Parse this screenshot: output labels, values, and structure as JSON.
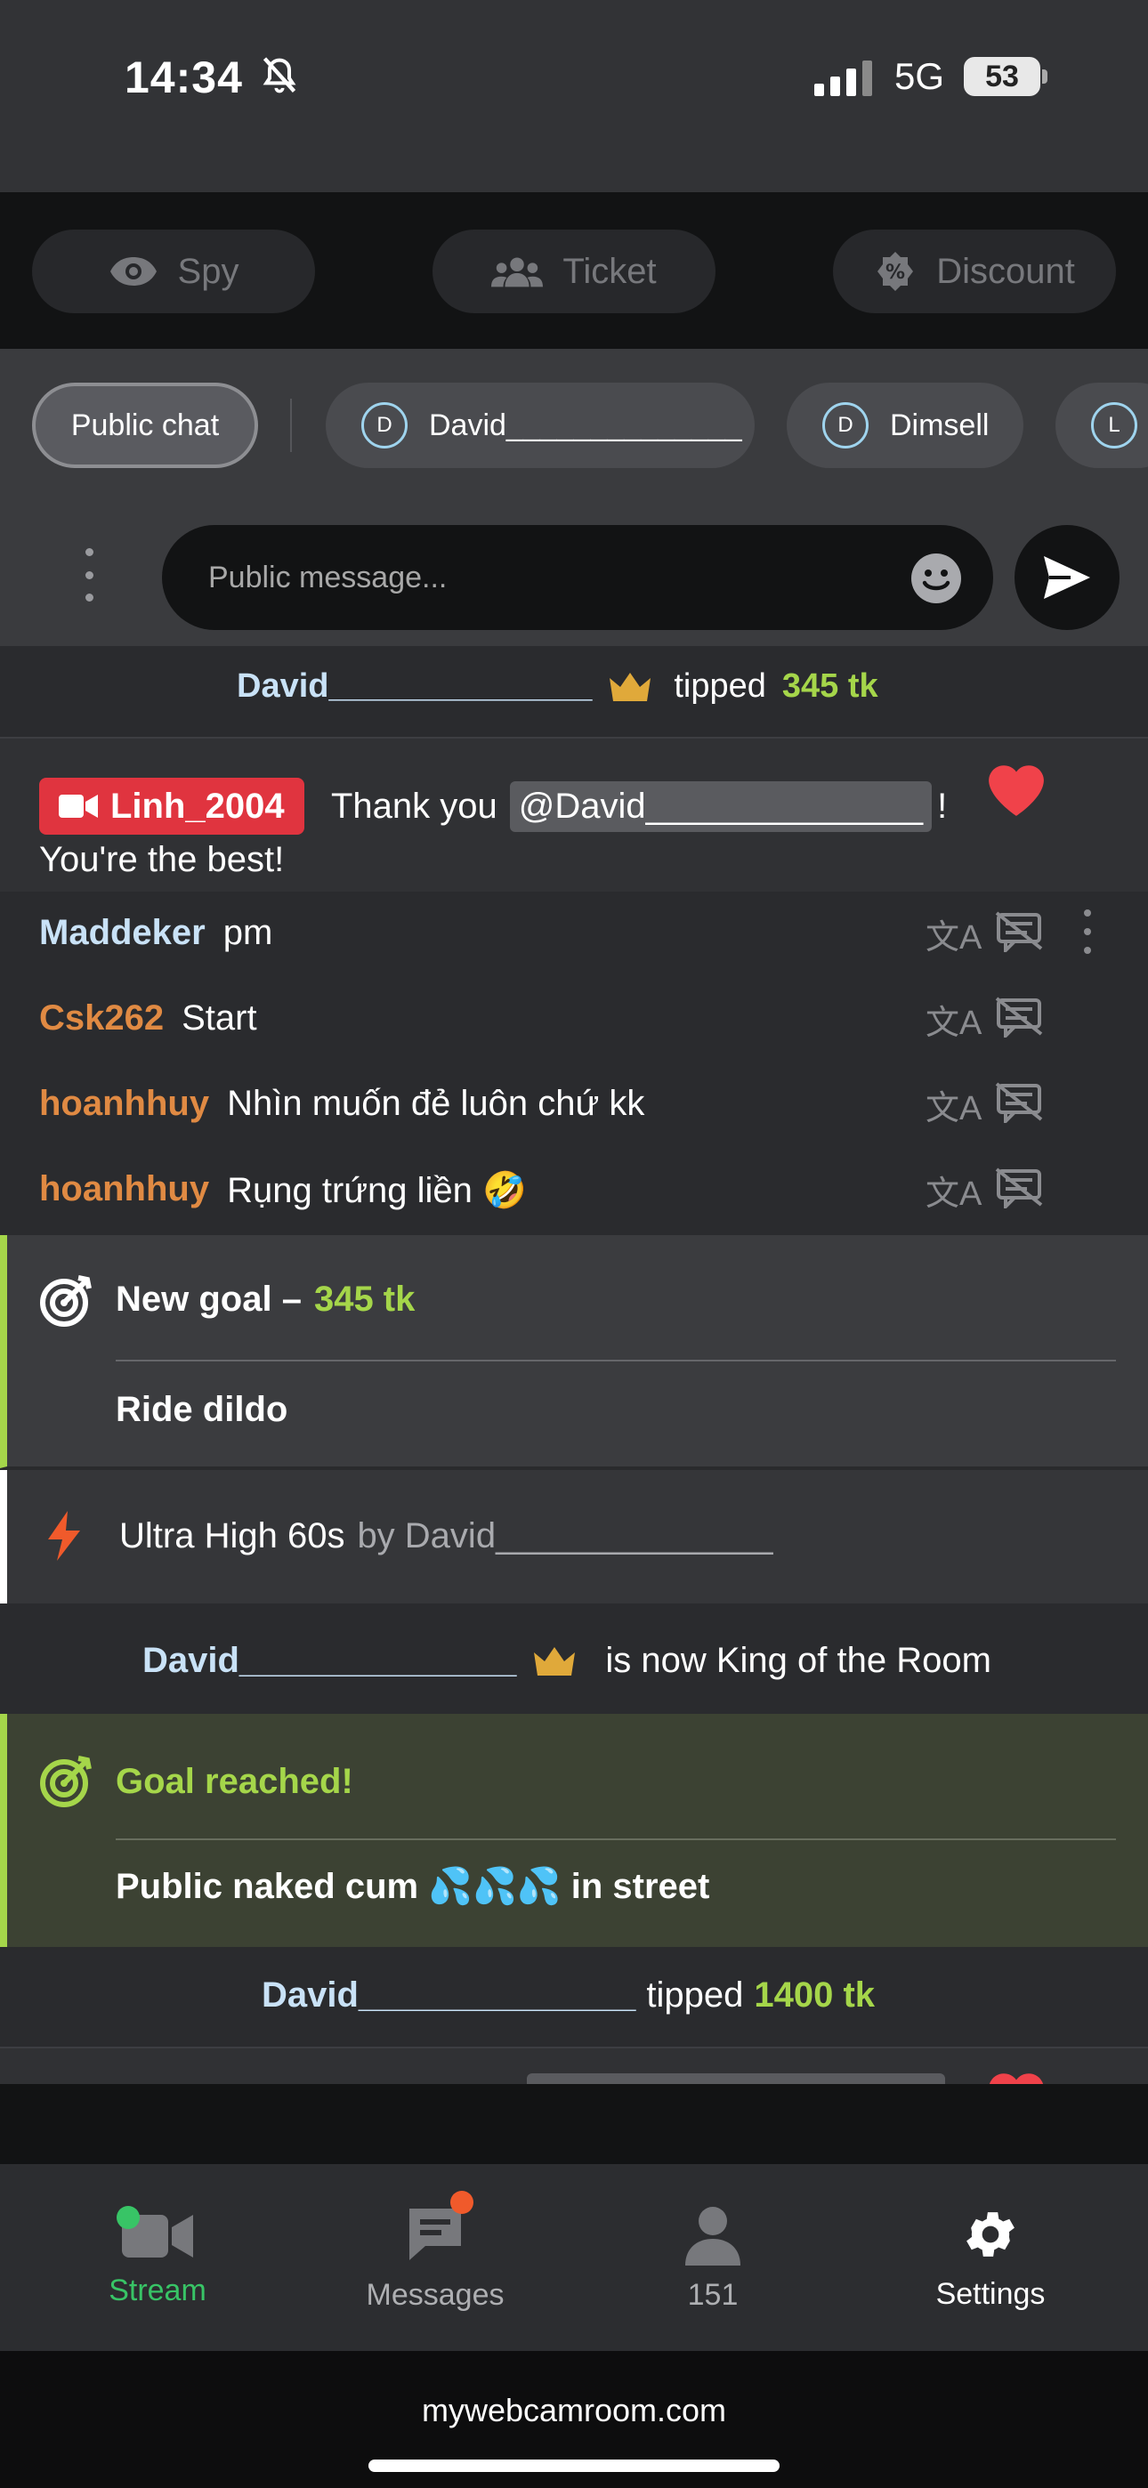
{
  "status": {
    "time": "14:34",
    "network": "5G",
    "battery": "53"
  },
  "actions": [
    {
      "label": "Spy",
      "icon": "eye-icon"
    },
    {
      "label": "Ticket",
      "icon": "users-icon"
    },
    {
      "label": "Discount",
      "icon": "percent-badge-icon"
    }
  ],
  "tabs": {
    "public": "Public chat",
    "users": [
      {
        "initial": "D",
        "name": "David______________"
      },
      {
        "initial": "D",
        "name": "Dimsell"
      },
      {
        "initial": "L",
        "name": ""
      }
    ]
  },
  "input": {
    "placeholder": "Public message..."
  },
  "feed": {
    "tip1": {
      "user": "David______________",
      "verb": "tipped",
      "amount": "345 tk"
    },
    "host_msg": {
      "badge": "Linh_2004",
      "text1": "Thank you",
      "mention": "@David______________",
      "text2": "!",
      "text3": "You're the best!"
    },
    "messages": [
      {
        "user": "Maddeker",
        "text": "pm",
        "color": "#c9e2f7"
      },
      {
        "user": "Csk262",
        "text": "Start",
        "color": "#e08a43"
      },
      {
        "user": "hoanhhuy",
        "text": "Nhìn muốn đẻ luôn chứ kk",
        "color": "#e08a43"
      },
      {
        "user": "hoanhhuy",
        "text": "Rụng trứng liền 🤣",
        "color": "#e08a43"
      }
    ],
    "goal_new": {
      "title": "New goal –",
      "amount": "345 tk",
      "desc": "Ride dildo"
    },
    "ultra": {
      "title": "Ultra High 60s",
      "by": "by David______________"
    },
    "king": {
      "user": "David______________",
      "text": "is now King of the Room"
    },
    "goal_reached": {
      "title": "Goal reached!",
      "desc": "Public naked cum 💦💦💦 in street"
    },
    "tip2": {
      "user": "David______________",
      "verb": "tipped",
      "amount": "1400 tk"
    }
  },
  "nav": [
    {
      "label": "Stream",
      "icon": "video-camera-icon"
    },
    {
      "label": "Messages",
      "icon": "chat-bubble-icon"
    },
    {
      "label": "151",
      "icon": "person-icon"
    },
    {
      "label": "Settings",
      "icon": "gear-icon"
    }
  ],
  "url": "mywebcamroom.com",
  "colors": {
    "accent_green": "#a5d64a",
    "stream_green": "#38c466",
    "tag_red": "#e0343f",
    "heart": "#f0424a"
  }
}
